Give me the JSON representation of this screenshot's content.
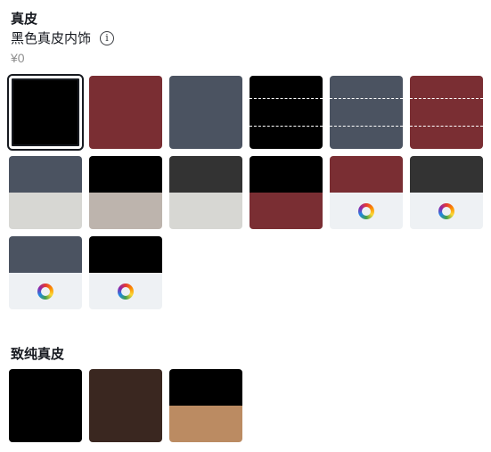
{
  "section1": {
    "title": "真皮",
    "selected_name": "黑色真皮内饰",
    "price": "¥0",
    "info_icon": "info-icon"
  },
  "section2": {
    "title": "致纯真皮"
  },
  "colors": {
    "black": "#000000",
    "red": "#7a2e33",
    "slate": "#4b5361",
    "charcoal": "#333333",
    "light_gray": "#d7d7d3",
    "taupe": "#bdb4ad",
    "light_panel": "#eef1f4",
    "dark_brown": "#3a2720",
    "tan": "#bb8b62"
  },
  "section1_swatches": [
    {
      "id": "black-solid",
      "style": "solid",
      "top": "black",
      "selected": true
    },
    {
      "id": "red-solid",
      "style": "solid",
      "top": "red"
    },
    {
      "id": "slate-solid",
      "style": "solid",
      "top": "slate"
    },
    {
      "id": "black-stitched",
      "style": "stitched",
      "top": "black"
    },
    {
      "id": "slate-stitched",
      "style": "stitched",
      "top": "slate"
    },
    {
      "id": "red-stitched",
      "style": "stitched",
      "top": "red"
    },
    {
      "id": "slate-light",
      "style": "split",
      "top": "slate",
      "bottom": "light_gray"
    },
    {
      "id": "black-taupe",
      "style": "split",
      "top": "black",
      "bottom": "taupe"
    },
    {
      "id": "charcoal-light",
      "style": "split",
      "top": "charcoal",
      "bottom": "light_gray"
    },
    {
      "id": "black-red",
      "style": "split",
      "top": "black",
      "bottom": "red"
    },
    {
      "id": "red-custom",
      "style": "custom",
      "top": "red",
      "bottom": "light_panel"
    },
    {
      "id": "charcoal-custom",
      "style": "custom",
      "top": "charcoal",
      "bottom": "light_panel"
    },
    {
      "id": "slate-custom",
      "style": "custom",
      "top": "slate",
      "bottom": "light_panel"
    },
    {
      "id": "black-custom",
      "style": "custom",
      "top": "black",
      "bottom": "light_panel"
    }
  ],
  "section2_swatches": [
    {
      "id": "pure-black",
      "style": "solid",
      "top": "black"
    },
    {
      "id": "pure-brown",
      "style": "solid",
      "top": "dark_brown"
    },
    {
      "id": "pure-black-tan",
      "style": "split",
      "top": "black",
      "bottom": "tan"
    }
  ]
}
